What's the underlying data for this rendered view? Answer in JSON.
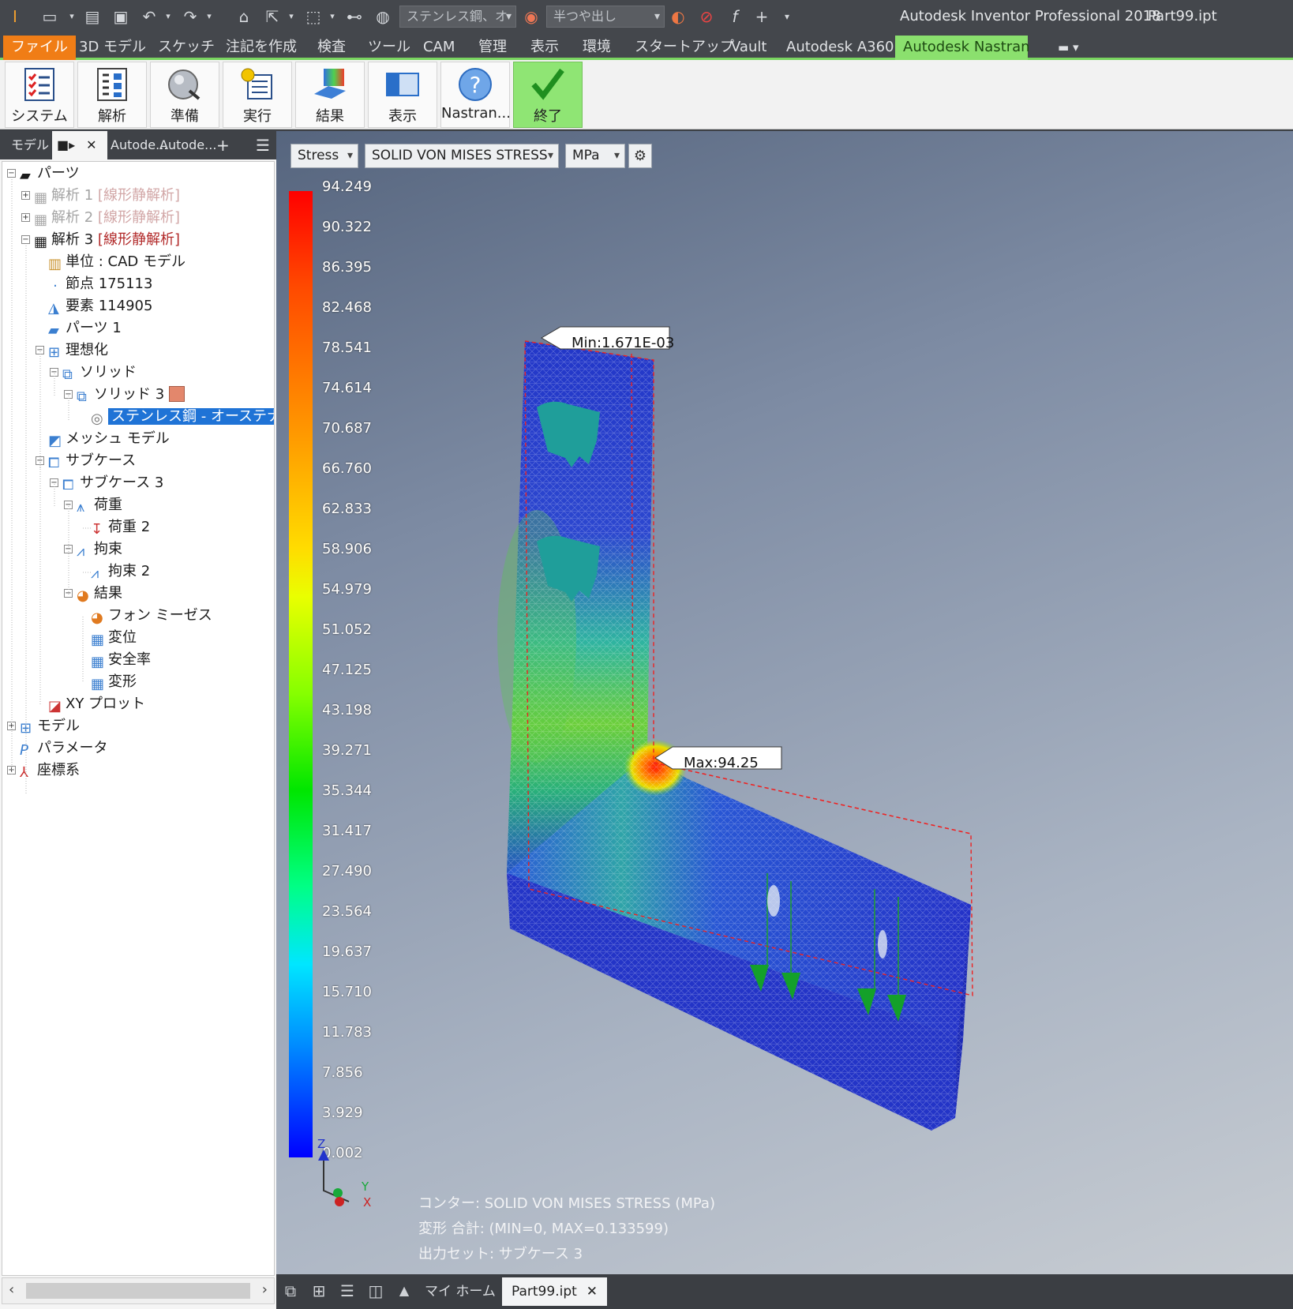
{
  "app": {
    "title": "Autodesk Inventor Professional 2018",
    "file": "Part99.ipt"
  },
  "quick_access": {
    "material": "ステンレス鋼、オ",
    "appearance": "半つや出し"
  },
  "ribbon_tabs": [
    {
      "label": "ファイル"
    },
    {
      "label": "3D モデル"
    },
    {
      "label": "スケッチ"
    },
    {
      "label": "注記を作成"
    },
    {
      "label": "検査"
    },
    {
      "label": "ツール"
    },
    {
      "label": "CAM"
    },
    {
      "label": "管理"
    },
    {
      "label": "表示"
    },
    {
      "label": "環境"
    },
    {
      "label": "スタートアップ"
    },
    {
      "label": "Vault"
    },
    {
      "label": "Autodesk A360"
    },
    {
      "label": "Autodesk Nastran"
    }
  ],
  "ribbon_buttons": [
    {
      "label": "システム",
      "icon": "system-checklist-icon"
    },
    {
      "label": "解析",
      "icon": "analysis-icon"
    },
    {
      "label": "準備",
      "icon": "prepare-icon"
    },
    {
      "label": "実行",
      "icon": "run-icon"
    },
    {
      "label": "結果",
      "icon": "results-icon"
    },
    {
      "label": "表示",
      "icon": "display-icon"
    },
    {
      "label": "Nastran...",
      "icon": "help-icon"
    },
    {
      "label": "終了",
      "icon": "finish-check-icon"
    }
  ],
  "panel_tabs": {
    "model": "モデル",
    "tab2": "Autode...",
    "tab3": "Autode..."
  },
  "tree": [
    {
      "label": "パーツ"
    },
    {
      "label": "解析 1",
      "tag": "[線形静解析]"
    },
    {
      "label": "解析 2",
      "tag": "[線形静解析]"
    },
    {
      "label": "解析 3",
      "tag": "[線形静解析]"
    },
    {
      "label": "単位 : CAD モデル"
    },
    {
      "label": "節点 175113"
    },
    {
      "label": "要素 114905"
    },
    {
      "label": "パーツ 1"
    },
    {
      "label": "理想化"
    },
    {
      "label": "ソリッド"
    },
    {
      "label": "ソリッド 3"
    },
    {
      "label": "ステンレス鋼 - オーステナイト系"
    },
    {
      "label": "メッシュ モデル"
    },
    {
      "label": "サブケース"
    },
    {
      "label": "サブケース 3"
    },
    {
      "label": "荷重"
    },
    {
      "label": "荷重 2"
    },
    {
      "label": "拘束"
    },
    {
      "label": "拘束 2"
    },
    {
      "label": "結果"
    },
    {
      "label": "フォン ミーゼス"
    },
    {
      "label": "変位"
    },
    {
      "label": "安全率"
    },
    {
      "label": "変形"
    },
    {
      "label": "XY プロット"
    },
    {
      "label": "モデル"
    },
    {
      "label": "パラメータ"
    },
    {
      "label": "座標系"
    }
  ],
  "viewport": {
    "result_type": "Stress",
    "component": "SOLID VON MISES STRESS",
    "unit": "MPa",
    "legend_values": [
      "94.249",
      "90.322",
      "86.395",
      "82.468",
      "78.541",
      "74.614",
      "70.687",
      "66.760",
      "62.833",
      "58.906",
      "54.979",
      "51.052",
      "47.125",
      "43.198",
      "39.271",
      "35.344",
      "31.417",
      "27.490",
      "23.564",
      "19.637",
      "15.710",
      "11.783",
      "7.856",
      "3.929",
      "0.002"
    ],
    "min_label": "Min:1.671E-03",
    "max_label": "Max:94.25",
    "info_contour": "コンター: SOLID VON MISES STRESS (MPa)",
    "info_deform": "変形 合計: (MIN=0, MAX=0.133599)",
    "info_output": "出力セット: サブケース 3",
    "axis_z": "Z",
    "axis_y": "Y",
    "axis_x": "X"
  },
  "bottom_tabs": {
    "home": "マイ ホーム",
    "doc": "Part99.ipt"
  },
  "colors": {
    "accent_file": "#f07d16",
    "accent_nastran": "#8be06e",
    "selection": "#1f73d6"
  }
}
